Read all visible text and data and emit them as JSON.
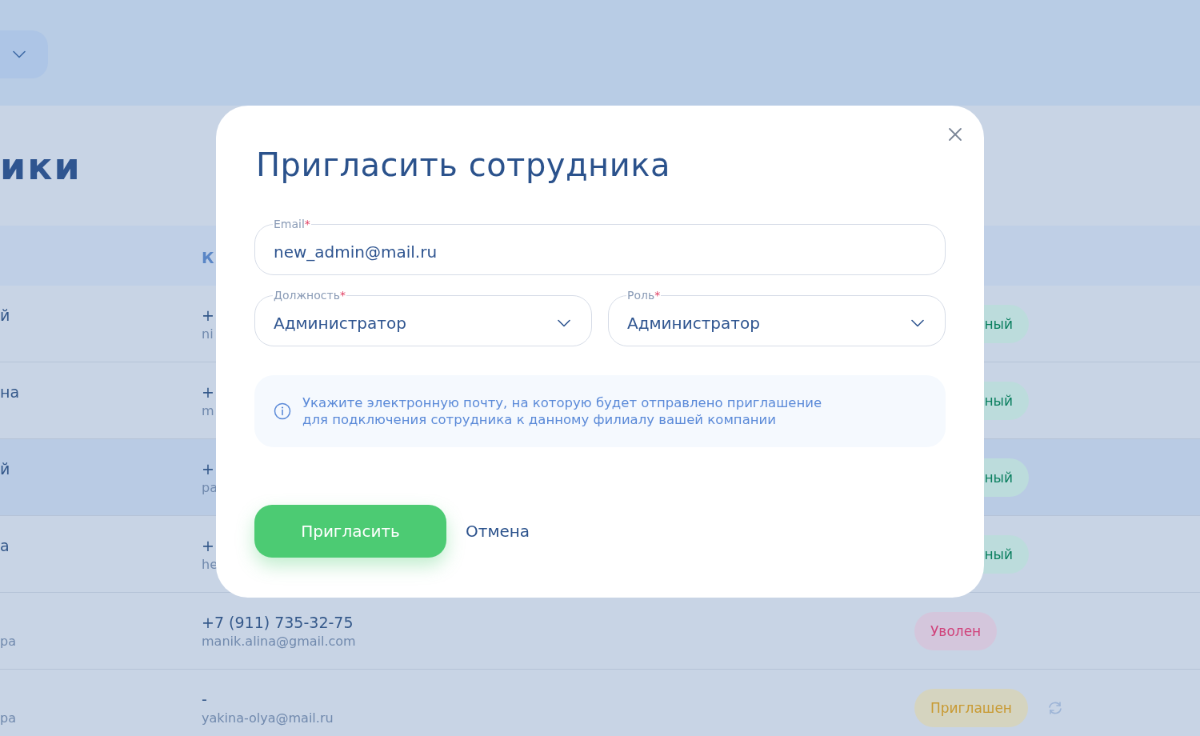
{
  "header": {
    "dropdown": {
      "expanded": false
    }
  },
  "page_title": "ики",
  "table": {
    "columns": [
      "К"
    ],
    "rows": [
      {
        "name_line_1": "й",
        "phone": "+",
        "email": "ni",
        "status": "ный",
        "kind": "active",
        "selected": false
      },
      {
        "name_line_1": "на",
        "phone": "+",
        "email": "m",
        "status": "ный",
        "kind": "active",
        "selected": false
      },
      {
        "name_line_1": "й",
        "phone": "+",
        "email": "pa",
        "status": "ный",
        "kind": "active",
        "selected": true
      },
      {
        "name_line_1": "а",
        "phone": "+",
        "email": "he",
        "status": "ный",
        "kind": "active",
        "selected": false
      },
      {
        "name_line_2": "ра",
        "phone": "+7 (911) 735-32-75",
        "email": "manik.alina@gmail.com",
        "status": "Уволен",
        "kind": "fired",
        "selected": false
      },
      {
        "name_line_2": "ра",
        "phone": "-",
        "email": "yakina-olya@mail.ru",
        "status": "Приглашен",
        "kind": "invited",
        "selected": false
      }
    ]
  },
  "modal": {
    "title": "Пригласить сотрудника",
    "fields": [
      {
        "kind": "input",
        "label": "Email",
        "required_mark": "*",
        "value": "new_admin@mail.ru"
      },
      {
        "kind": "select",
        "label": "Должность",
        "required_mark": "*",
        "value": "Администратор"
      },
      {
        "kind": "select",
        "label": "Роль",
        "required_mark": "*",
        "value": "Администратор"
      }
    ],
    "info": "Укажите электронную почту, на которую будет отправлено приглашение\nдля подключения сотрудника к данному филиалу вашей компании",
    "primary_button": "Пригласить",
    "secondary_button": "Отмена"
  }
}
